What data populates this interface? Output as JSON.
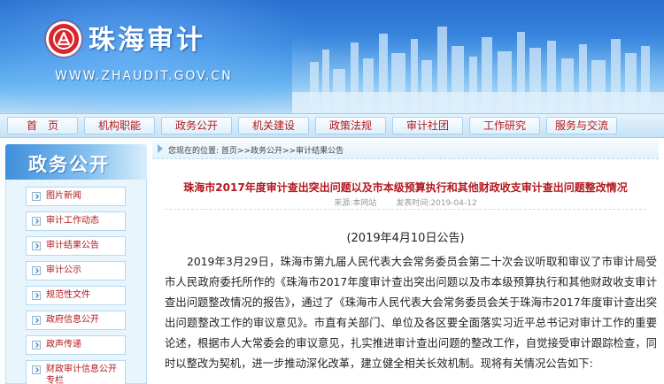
{
  "header": {
    "site_title": "珠海审计",
    "site_url": "WWW.ZHAUDIT.GOV.CN"
  },
  "nav": {
    "items": [
      "首　页",
      "机构职能",
      "政务公开",
      "机关建设",
      "政策法规",
      "审计社团",
      "工作研究",
      "服务与交流"
    ]
  },
  "sidebar": {
    "title": "政务公开",
    "items": [
      {
        "label": "图片新闻"
      },
      {
        "label": "审计工作动态"
      },
      {
        "label": "审计结果公告"
      },
      {
        "label": "审计公示"
      },
      {
        "label": "规范性文件"
      },
      {
        "label": "政府信息公开"
      },
      {
        "label": "政声传递"
      },
      {
        "label": "财政审计信息公开专栏"
      }
    ]
  },
  "breadcrumb": {
    "prefix": "您现在的位置:",
    "path": "首页>>政务公开>>审计结果公告"
  },
  "article": {
    "title": "珠海市2017年度审计查出突出问题以及市本级预算执行和其他财政收支审计查出问题整改情况",
    "source": "来源:本网站",
    "published": "发表时间:2019-04-12",
    "announce_date": "(2019年4月10日公告)",
    "body": "2019年3月29日，珠海市第九届人民代表大会常务委员会第二十次会议听取和审议了市审计局受市人民政府委托所作的《珠海市2017年度审计查出突出问题以及市本级预算执行和其他财政收支审计查出问题整改情况的报告》，通过了《珠海市人民代表大会常务委员会关于珠海市2017年度审计查出突出问题整改工作的审议意见》。市直有关部门、单位及各区要全面落实习近平总书记对审计工作的重要论述，根据市人大常委会的审议意见，扎实推进审计查出问题的整改工作，自觉接受审计跟踪检查，同时以整改为契机，进一步推动深化改革，建立健全相关长效机制。现将有关情况公告如下:"
  },
  "colors": {
    "accent_red": "#b4171d",
    "banner_blue": "#2a6fd0",
    "nav_bg": "#c4e2f7"
  },
  "icons": [
    "logo-emblem-icon",
    "skyline-graphic",
    "breadcrumb-arrow-icon",
    "chevron-right-icon"
  ]
}
